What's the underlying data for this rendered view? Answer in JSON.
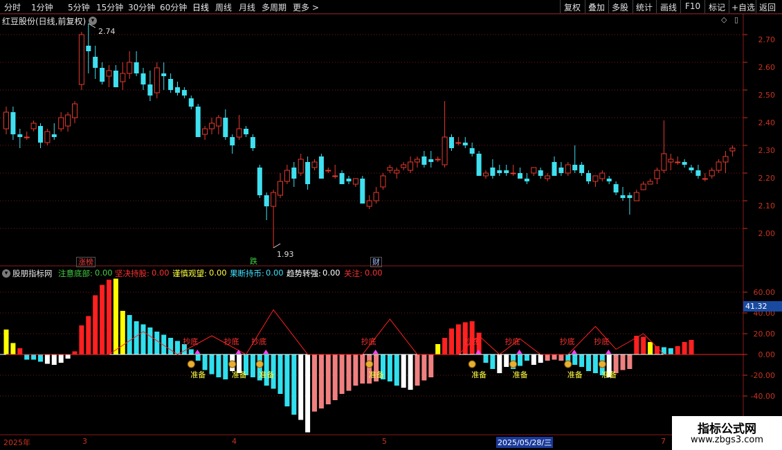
{
  "toolbar": {
    "timeframes": [
      "分时",
      "1分钟",
      "5分钟",
      "15分钟",
      "30分钟",
      "60分钟",
      "日线",
      "周线",
      "月线",
      "多周期",
      "更多 >"
    ],
    "active": "日线",
    "right_buttons": [
      "复权",
      "叠加",
      "多股",
      "统计",
      "画线",
      "F10",
      "标记",
      "+自选",
      "返回"
    ]
  },
  "stock": {
    "title": "红豆股份(日线,前复权)",
    "high_label": "2.74",
    "low_label": "1.93"
  },
  "events": [
    {
      "label": "涨榜",
      "color": "#e84040"
    },
    {
      "label": "跌",
      "color": "#40d040"
    },
    {
      "label": "财",
      "color": "#a0c0ff"
    }
  ],
  "indicator": {
    "name": "股朋指标网",
    "fields": [
      {
        "label": "注意底部:",
        "value": "0.00",
        "color": "#40d040"
      },
      {
        "label": "坚决持股:",
        "value": "0.00",
        "color": "#ff3030"
      },
      {
        "label": "谨慎观望:",
        "value": "0.00",
        "color": "#ffff40"
      },
      {
        "label": "果断持币:",
        "value": "0.00",
        "color": "#40e0ff"
      },
      {
        "label": "趋势转强:",
        "value": "0.00",
        "color": "#ffffff"
      },
      {
        "label": "关注:",
        "value": "0.00",
        "color": "#ff3030"
      }
    ],
    "current_value": "41.32",
    "signal_top": "抄底",
    "signal_bottom": "准备"
  },
  "axis": {
    "price_ticks": [
      "2.70",
      "2.60",
      "2.50",
      "2.40",
      "2.30",
      "2.20",
      "2.10",
      "2.00"
    ],
    "indicator_ticks": [
      "60.00",
      "40.00",
      "20.00",
      "0.00",
      "-20.00",
      "-40.00"
    ]
  },
  "dates": {
    "year": "2025年",
    "m3": "3",
    "m4": "4",
    "m5": "5",
    "cursor": "2025/05/28/三",
    "m7": "7"
  },
  "watermark": {
    "line1": "指标公式网",
    "line2": "www.zbgs3.com"
  },
  "colors": {
    "up": "#e83a2e",
    "down": "#3fe0f0",
    "grid": "#7a1a1a",
    "axis": "#c8341f"
  },
  "chart_data": {
    "type": "candlestick",
    "price_range": [
      1.88,
      2.8
    ],
    "candles": [
      [
        2.36,
        2.44,
        2.34,
        2.42
      ],
      [
        2.42,
        2.44,
        2.32,
        2.34
      ],
      [
        2.34,
        2.36,
        2.29,
        2.33
      ],
      [
        2.33,
        2.35,
        2.32,
        2.33
      ],
      [
        2.36,
        2.39,
        2.35,
        2.38
      ],
      [
        2.37,
        2.38,
        2.29,
        2.31
      ],
      [
        2.31,
        2.36,
        2.3,
        2.35
      ],
      [
        2.34,
        2.38,
        2.32,
        2.33
      ],
      [
        2.36,
        2.42,
        2.35,
        2.4
      ],
      [
        2.37,
        2.42,
        2.35,
        2.41
      ],
      [
        2.4,
        2.46,
        2.38,
        2.45
      ],
      [
        2.52,
        2.71,
        2.5,
        2.7
      ],
      [
        2.66,
        2.74,
        2.56,
        2.64
      ],
      [
        2.62,
        2.66,
        2.54,
        2.58
      ],
      [
        2.58,
        2.6,
        2.52,
        2.53
      ],
      [
        2.55,
        2.59,
        2.51,
        2.57
      ],
      [
        2.57,
        2.59,
        2.51,
        2.51
      ],
      [
        2.53,
        2.6,
        2.5,
        2.56
      ],
      [
        2.56,
        2.64,
        2.54,
        2.6
      ],
      [
        2.6,
        2.64,
        2.55,
        2.56
      ],
      [
        2.56,
        2.58,
        2.5,
        2.52
      ],
      [
        2.52,
        2.57,
        2.46,
        2.48
      ],
      [
        2.49,
        2.6,
        2.47,
        2.58
      ],
      [
        2.56,
        2.6,
        2.5,
        2.55
      ],
      [
        2.54,
        2.56,
        2.49,
        2.5
      ],
      [
        2.51,
        2.53,
        2.48,
        2.49
      ],
      [
        2.5,
        2.51,
        2.47,
        2.48
      ],
      [
        2.47,
        2.48,
        2.43,
        2.44
      ],
      [
        2.44,
        2.45,
        2.34,
        2.33
      ],
      [
        2.34,
        2.37,
        2.32,
        2.36
      ],
      [
        2.36,
        2.4,
        2.34,
        2.38
      ],
      [
        2.37,
        2.41,
        2.34,
        2.4
      ],
      [
        2.4,
        2.43,
        2.32,
        2.33
      ],
      [
        2.33,
        2.34,
        2.27,
        2.3
      ],
      [
        2.33,
        2.41,
        2.32,
        2.36
      ],
      [
        2.36,
        2.37,
        2.33,
        2.34
      ],
      [
        2.33,
        2.34,
        2.28,
        2.29
      ],
      [
        2.22,
        2.23,
        2.11,
        2.12
      ],
      [
        2.12,
        2.13,
        2.03,
        2.08
      ],
      [
        2.08,
        2.14,
        1.93,
        2.13
      ],
      [
        2.12,
        2.2,
        2.11,
        2.17
      ],
      [
        2.17,
        2.23,
        2.16,
        2.21
      ],
      [
        2.22,
        2.24,
        2.15,
        2.18
      ],
      [
        2.2,
        2.27,
        2.19,
        2.25
      ],
      [
        2.24,
        2.26,
        2.14,
        2.16
      ],
      [
        2.22,
        2.25,
        2.21,
        2.24
      ],
      [
        2.26,
        2.27,
        2.18,
        2.18
      ],
      [
        2.21,
        2.22,
        2.2,
        2.21
      ],
      [
        2.19,
        2.23,
        2.18,
        2.19
      ],
      [
        2.2,
        2.21,
        2.16,
        2.16
      ],
      [
        2.18,
        2.19,
        2.16,
        2.17
      ],
      [
        2.16,
        2.18,
        2.15,
        2.18
      ],
      [
        2.18,
        2.19,
        2.09,
        2.09
      ],
      [
        2.08,
        2.12,
        2.07,
        2.1
      ],
      [
        2.1,
        2.15,
        2.09,
        2.13
      ],
      [
        2.15,
        2.2,
        2.14,
        2.19
      ],
      [
        2.21,
        2.23,
        2.2,
        2.22
      ],
      [
        2.2,
        2.22,
        2.18,
        2.21
      ],
      [
        2.22,
        2.24,
        2.21,
        2.23
      ],
      [
        2.21,
        2.26,
        2.2,
        2.24
      ],
      [
        2.24,
        2.26,
        2.22,
        2.25
      ],
      [
        2.26,
        2.28,
        2.22,
        2.23
      ],
      [
        2.25,
        2.28,
        2.22,
        2.24
      ],
      [
        2.25,
        2.26,
        2.24,
        2.25
      ],
      [
        2.23,
        2.46,
        2.22,
        2.33
      ],
      [
        2.33,
        2.34,
        2.28,
        2.29
      ],
      [
        2.31,
        2.33,
        2.3,
        2.31
      ],
      [
        2.31,
        2.33,
        2.29,
        2.3
      ],
      [
        2.29,
        2.31,
        2.26,
        2.27
      ],
      [
        2.27,
        2.28,
        2.19,
        2.19
      ],
      [
        2.19,
        2.21,
        2.18,
        2.2
      ],
      [
        2.22,
        2.25,
        2.18,
        2.19
      ],
      [
        2.21,
        2.23,
        2.19,
        2.2
      ],
      [
        2.21,
        2.23,
        2.19,
        2.2
      ],
      [
        2.2,
        2.23,
        2.19,
        2.2
      ],
      [
        2.2,
        2.22,
        2.18,
        2.18
      ],
      [
        2.18,
        2.2,
        2.16,
        2.17
      ],
      [
        2.2,
        2.22,
        2.19,
        2.22
      ],
      [
        2.21,
        2.22,
        2.18,
        2.19
      ],
      [
        2.18,
        2.2,
        2.17,
        2.19
      ],
      [
        2.24,
        2.26,
        2.19,
        2.19
      ],
      [
        2.22,
        2.24,
        2.19,
        2.2
      ],
      [
        2.2,
        2.24,
        2.19,
        2.23
      ],
      [
        2.23,
        2.3,
        2.2,
        2.21
      ],
      [
        2.23,
        2.24,
        2.19,
        2.2
      ],
      [
        2.2,
        2.21,
        2.16,
        2.17
      ],
      [
        2.17,
        2.19,
        2.15,
        2.19
      ],
      [
        2.18,
        2.21,
        2.17,
        2.2
      ],
      [
        2.18,
        2.19,
        2.16,
        2.17
      ],
      [
        2.16,
        2.17,
        2.12,
        2.13
      ],
      [
        2.12,
        2.15,
        2.1,
        2.11
      ],
      [
        2.12,
        2.13,
        2.05,
        2.11
      ],
      [
        2.1,
        2.14,
        2.1,
        2.13
      ],
      [
        2.14,
        2.17,
        2.14,
        2.16
      ],
      [
        2.16,
        2.18,
        2.16,
        2.17
      ],
      [
        2.18,
        2.22,
        2.16,
        2.21
      ],
      [
        2.21,
        2.39,
        2.2,
        2.27
      ],
      [
        2.24,
        2.27,
        2.21,
        2.25
      ],
      [
        2.24,
        2.26,
        2.23,
        2.24
      ],
      [
        2.24,
        2.25,
        2.22,
        2.23
      ],
      [
        2.22,
        2.23,
        2.2,
        2.21
      ],
      [
        2.21,
        2.23,
        2.18,
        2.19
      ],
      [
        2.18,
        2.2,
        2.17,
        2.18
      ],
      [
        2.19,
        2.22,
        2.18,
        2.21
      ],
      [
        2.21,
        2.25,
        2.2,
        2.24
      ],
      [
        2.24,
        2.28,
        2.2,
        2.26
      ],
      [
        2.28,
        2.3,
        2.26,
        2.29
      ]
    ],
    "indicator": {
      "range": [
        -60,
        80
      ],
      "bars": [
        [
          24,
          "yellow"
        ],
        [
          11,
          "yellow"
        ],
        [
          6,
          "red"
        ],
        [
          -5,
          "cyan"
        ],
        [
          -5,
          "cyan"
        ],
        [
          -7,
          "cyan"
        ],
        [
          -9,
          "white"
        ],
        [
          -10,
          "white"
        ],
        [
          -8,
          "white"
        ],
        [
          -4,
          "white"
        ],
        [
          3,
          "red"
        ],
        [
          28,
          "red"
        ],
        [
          37,
          "red"
        ],
        [
          57,
          "red"
        ],
        [
          67,
          "red"
        ],
        [
          72,
          "red"
        ],
        [
          73,
          "yellow"
        ],
        [
          42,
          "yellow"
        ],
        [
          38,
          "cyan"
        ],
        [
          32,
          "cyan"
        ],
        [
          29,
          "cyan"
        ],
        [
          26,
          "cyan"
        ],
        [
          22,
          "cyan"
        ],
        [
          19,
          "cyan"
        ],
        [
          16,
          "cyan"
        ],
        [
          13,
          "cyan"
        ],
        [
          10,
          "cyan"
        ],
        [
          5,
          "cyan"
        ],
        [
          -6,
          "cyan"
        ],
        [
          -15,
          "cyan"
        ],
        [
          -19,
          "cyan"
        ],
        [
          -22,
          "cyan"
        ],
        [
          -24,
          "cyan"
        ],
        [
          -16,
          "white"
        ],
        [
          -18,
          "white"
        ],
        [
          -20,
          "cyan"
        ],
        [
          -22,
          "cyan"
        ],
        [
          -25,
          "cyan"
        ],
        [
          -30,
          "cyan"
        ],
        [
          -33,
          "cyan"
        ],
        [
          -38,
          "cyan"
        ],
        [
          -50,
          "cyan"
        ],
        [
          -58,
          "cyan"
        ],
        [
          -63,
          "white"
        ],
        [
          -75,
          "white"
        ],
        [
          -55,
          "pink"
        ],
        [
          -52,
          "pink"
        ],
        [
          -48,
          "pink"
        ],
        [
          -44,
          "pink"
        ],
        [
          -38,
          "pink"
        ],
        [
          -35,
          "pink"
        ],
        [
          -30,
          "pink"
        ],
        [
          -28,
          "pink"
        ],
        [
          -28,
          "pink"
        ],
        [
          -26,
          "pink"
        ],
        [
          -24,
          "cyan"
        ],
        [
          -26,
          "cyan"
        ],
        [
          -30,
          "cyan"
        ],
        [
          -32,
          "white"
        ],
        [
          -34,
          "white"
        ],
        [
          -30,
          "pink"
        ],
        [
          -25,
          "pink"
        ],
        [
          -22,
          "pink"
        ],
        [
          10,
          "yellow"
        ],
        [
          16,
          "red"
        ],
        [
          25,
          "red"
        ],
        [
          29,
          "red"
        ],
        [
          31,
          "red"
        ],
        [
          32,
          "red"
        ],
        [
          21,
          "red"
        ],
        [
          -8,
          "cyan"
        ],
        [
          -14,
          "cyan"
        ],
        [
          -18,
          "white"
        ],
        [
          -12,
          "white"
        ],
        [
          -14,
          "cyan"
        ],
        [
          -11,
          "cyan"
        ],
        [
          -6,
          "cyan"
        ],
        [
          -10,
          "white"
        ],
        [
          -8,
          "white"
        ],
        [
          -6,
          "pink"
        ],
        [
          -5,
          "pink"
        ],
        [
          -6,
          "pink"
        ],
        [
          -8,
          "cyan"
        ],
        [
          -10,
          "cyan"
        ],
        [
          -12,
          "cyan"
        ],
        [
          -16,
          "cyan"
        ],
        [
          -18,
          "cyan"
        ],
        [
          -20,
          "cyan"
        ],
        [
          -22,
          "white"
        ],
        [
          -18,
          "pink"
        ],
        [
          -15,
          "pink"
        ],
        [
          -14,
          "pink"
        ],
        [
          18,
          "red"
        ],
        [
          17,
          "red"
        ],
        [
          12,
          "yellow"
        ],
        [
          8,
          "red"
        ],
        [
          7,
          "cyan"
        ],
        [
          6,
          "cyan"
        ],
        [
          8,
          "red"
        ],
        [
          12,
          "red"
        ],
        [
          14,
          "red"
        ]
      ],
      "line": [
        [
          0,
          0
        ],
        [
          15,
          0
        ],
        [
          20,
          22
        ],
        [
          25,
          0
        ],
        [
          30,
          18
        ],
        [
          35,
          0
        ],
        [
          39,
          43
        ],
        [
          44,
          0
        ],
        [
          52,
          0
        ],
        [
          56,
          34
        ],
        [
          60,
          0
        ],
        [
          66,
          0
        ],
        [
          69,
          18
        ],
        [
          72,
          0
        ],
        [
          75,
          15
        ],
        [
          78,
          0
        ],
        [
          82,
          0
        ],
        [
          86,
          27
        ],
        [
          89,
          5
        ],
        [
          93,
          20
        ],
        [
          96,
          0
        ],
        [
          100,
          0
        ],
        [
          108,
          0
        ]
      ],
      "signals": [
        27,
        33,
        37,
        53,
        68,
        74,
        82,
        87
      ]
    }
  }
}
